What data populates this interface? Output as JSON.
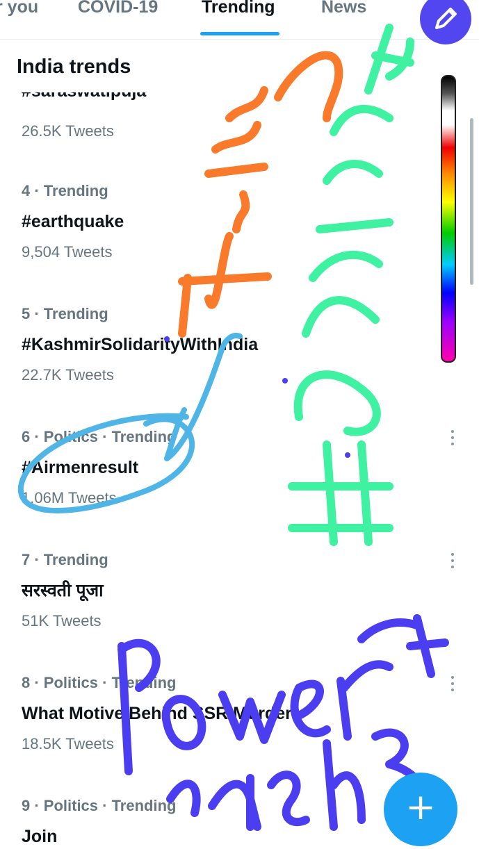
{
  "tabs": {
    "for_you": "r you",
    "covid": "COVID-19",
    "trending": "Trending",
    "news": "News"
  },
  "section_title": "India trends",
  "trends": [
    {
      "meta": "",
      "name": "#saraswatipuja",
      "count": "26.5K Tweets"
    },
    {
      "meta": "4 · Trending",
      "name": "#earthquake",
      "count": "9,504 Tweets"
    },
    {
      "meta": "5 · Trending",
      "name": "#KashmirSolidarityWithIndia",
      "count": "22.7K Tweets"
    },
    {
      "meta": "6 · Politics · Trending",
      "name": "#Airmenresult",
      "count": "1.06M Tweets"
    },
    {
      "meta": "7 · Trending",
      "name": "सरस्वती पूजा",
      "count": "51K Tweets"
    },
    {
      "meta": "8 · Politics · Trending",
      "name": "What Motive Behind SSR Murder",
      "count": "18.5K Tweets"
    },
    {
      "meta": "9 · Politics · Trending",
      "name": "Join",
      "count": ""
    }
  ],
  "fab": {
    "icon": "plus-icon"
  },
  "compose": {
    "icon": "pencil-icon"
  },
  "annotations": {
    "orange": "Trending",
    "green": "#Airmenresult",
    "purple": "Power of Shiksha",
    "colors": {
      "orange": "#f97a2a",
      "green": "#3ff2a2",
      "blue": "#4fb4e6",
      "purple": "#4a3ef0"
    }
  }
}
